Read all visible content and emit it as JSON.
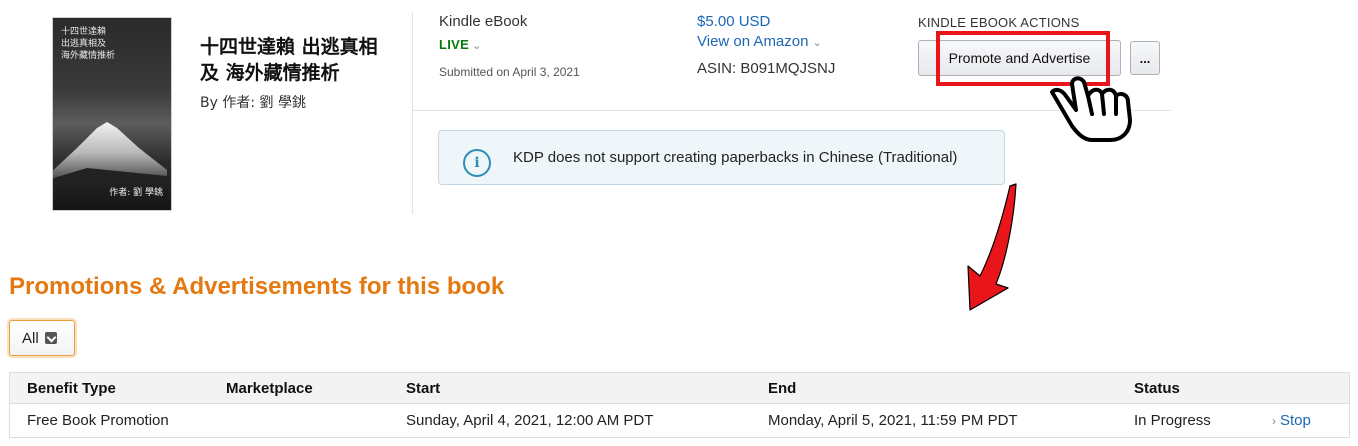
{
  "book": {
    "cover_title": "十四世達賴\n出逃真相及\n海外藏情推析",
    "cover_author": "作者: 劉 學銚",
    "title": "十四世達賴 出逃真相及 海外藏情推析",
    "author": "By 作者: 劉 學銚"
  },
  "format": {
    "type": "Kindle eBook",
    "status": "LIVE",
    "submitted": "Submitted on April 3, 2021"
  },
  "pricing": {
    "price": "$5.00 USD",
    "view_link": "View on Amazon",
    "asin": "ASIN: B091MQJSNJ"
  },
  "actions": {
    "label": "KINDLE EBOOK ACTIONS",
    "promote_button": "Promote and Advertise",
    "more_button": "..."
  },
  "alert": {
    "icon": "info-icon",
    "text": "KDP does not support creating paperbacks in Chinese (Traditional)"
  },
  "promotions": {
    "title": "Promotions & Advertisements for this book",
    "filter_value": "All",
    "columns": [
      "Benefit Type",
      "Marketplace",
      "Start",
      "End",
      "Status"
    ],
    "rows": [
      {
        "benefit_type": "Free Book Promotion",
        "marketplace": "",
        "start": "Sunday, April 4, 2021, 12:00 AM PDT",
        "end": "Monday, April 5, 2021, 11:59 PM PDT",
        "status": "In Progress",
        "action": "Stop"
      }
    ]
  },
  "annotation": {
    "highlight_color": "#e8161b",
    "pointer": "hand-pointer-icon",
    "arrow": "red-arrow"
  }
}
